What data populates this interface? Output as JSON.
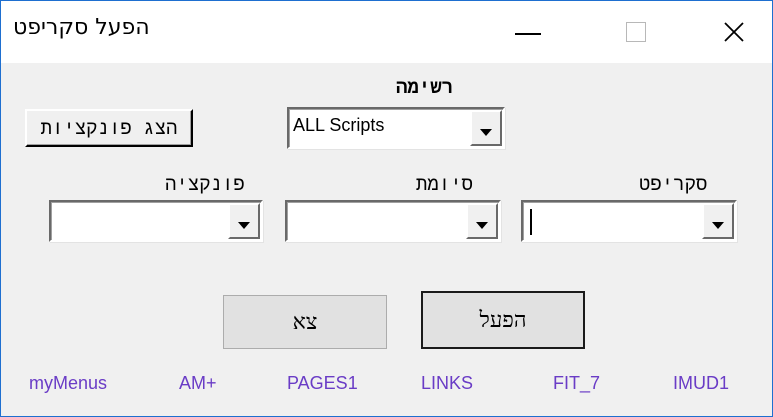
{
  "window": {
    "title": "הפעל סקריפט",
    "close_glyph": "✕"
  },
  "list": {
    "label": "רשימה",
    "selected": "ALL Scripts"
  },
  "show_functions_button": "הצג פונקציות",
  "fields": {
    "function_label": "פונקציה",
    "extension_label": "סיומת",
    "script_label": "סקריפט",
    "function_value": "",
    "extension_value": "",
    "script_value": ""
  },
  "buttons": {
    "exit": "צא",
    "run": "הפעל"
  },
  "links": [
    "myMenus",
    "AM+",
    "PAGES1",
    "LINKS",
    "FIT_7",
    "IMUD1"
  ],
  "colors": {
    "link": "#6a3cc6",
    "window_border": "#1e6fd0"
  }
}
